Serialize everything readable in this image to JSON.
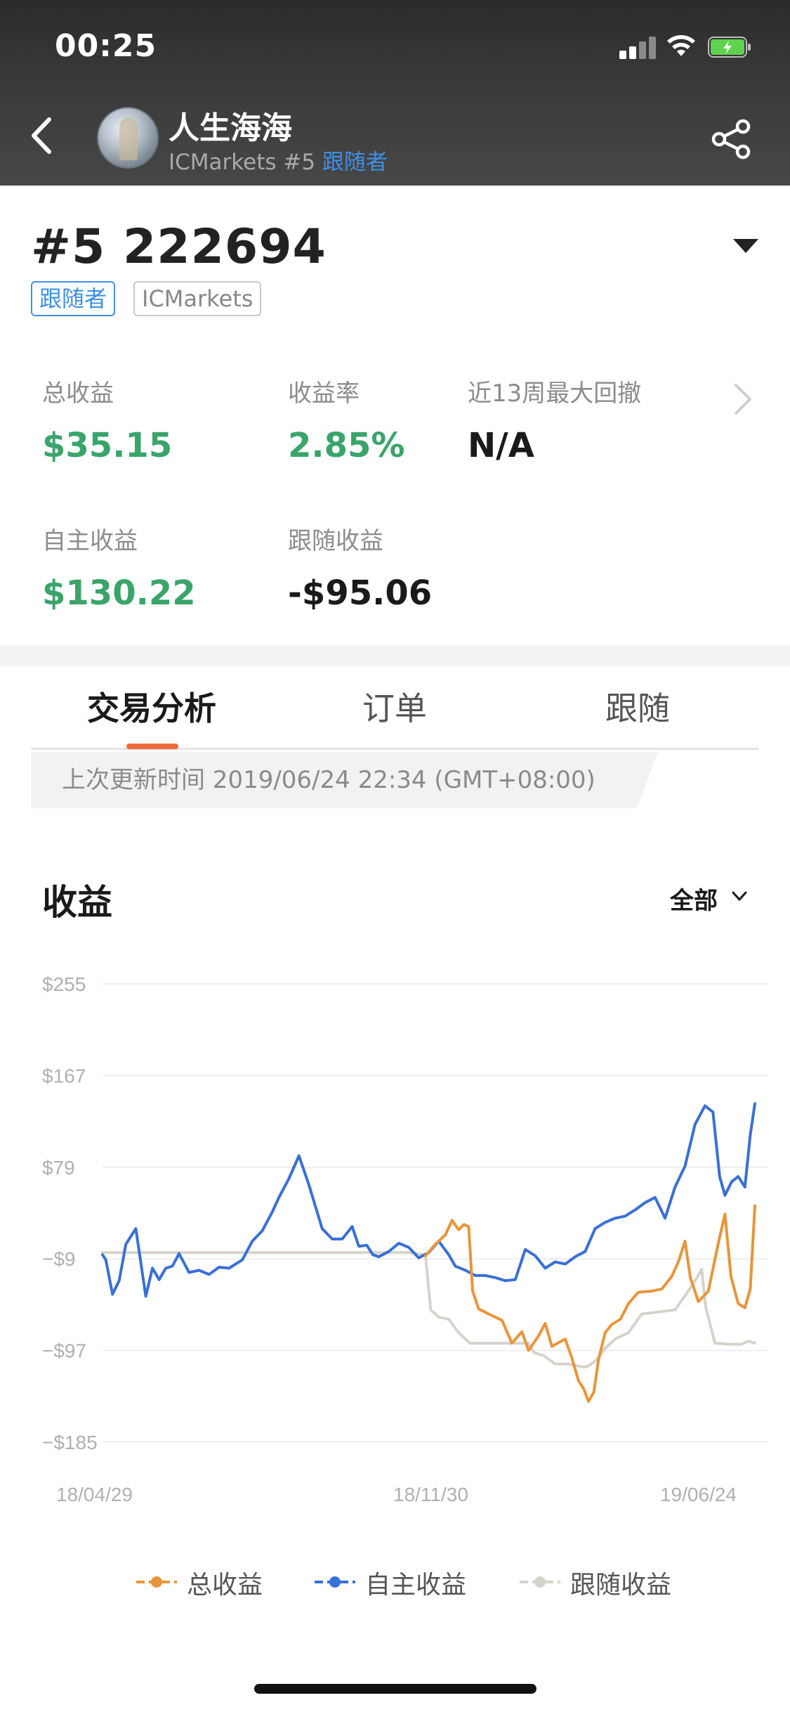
{
  "status_bar": {
    "time": "00:25"
  },
  "header": {
    "user_name": "人生海海",
    "broker_rank": "ICMarkets #5",
    "role": "跟随者"
  },
  "account": {
    "id": "#5 222694",
    "tags": [
      "跟随者",
      "ICMarkets"
    ]
  },
  "stats": {
    "total_profit": {
      "label": "总收益",
      "value": "$35.15"
    },
    "return_rate": {
      "label": "收益率",
      "value": "2.85%"
    },
    "max_drawdown": {
      "label": "近13周最大回撤",
      "value": "N/A"
    },
    "self_profit": {
      "label": "自主收益",
      "value": "$130.22"
    },
    "follow_profit": {
      "label": "跟随收益",
      "value": "-$95.06"
    }
  },
  "tabs": [
    "交易分析",
    "订单",
    "跟随"
  ],
  "update_text": "上次更新时间 2019/06/24 22:34 (GMT+08:00)",
  "chart_section": {
    "title": "收益",
    "filter": "全部"
  },
  "colors": {
    "green": "#3aa46b",
    "orange": "#e8953a",
    "blue": "#3a6fd6",
    "gray": "#d6d3cc",
    "accent": "#ec6b3a",
    "link": "#3f8fe6"
  },
  "chart_data": {
    "type": "line",
    "y_ticks": [
      "$255",
      "$167",
      "$79",
      "−$9",
      "−$97",
      "−$185"
    ],
    "x_ticks": [
      "18/04/29",
      "18/11/30",
      "19/06/24"
    ],
    "ylim": [
      -185,
      255
    ],
    "xlim": [
      0,
      100
    ],
    "grid": true,
    "legend_position": "bottom",
    "series": [
      {
        "name": "总收益",
        "color": "#e8953a",
        "x": [
          48.5,
          50,
          51.5,
          52.5,
          53.5,
          54.3,
          55,
          55.6,
          56.5,
          58,
          60,
          61.5,
          63,
          64,
          65.5,
          66.5,
          67.5,
          69.5,
          70.5,
          71.5,
          72.3,
          73,
          73.8,
          74.5,
          75.5,
          76.5,
          77.8,
          79,
          80.5,
          82.5,
          84,
          85.5,
          86.5,
          87.5,
          88.3,
          89.5,
          91,
          92.5,
          93.5,
          94.4,
          95.5,
          96.5,
          97.3,
          98
        ],
        "y": [
          -6,
          5,
          14,
          28,
          19,
          24,
          22,
          -40,
          -57,
          -62,
          -68,
          -90,
          -79,
          -97,
          -83,
          -71,
          -93,
          -86,
          -104,
          -126,
          -134,
          -146,
          -137,
          -106,
          -80,
          -72,
          -67,
          -52,
          -41,
          -40,
          -38,
          -26,
          -12,
          8,
          -27,
          -50,
          -40,
          6,
          34,
          -26,
          -52,
          -56,
          -38,
          42
        ]
      },
      {
        "name": "自主收益",
        "color": "#3a6fd6",
        "x": [
          0,
          0.5,
          1.5,
          2.5,
          3.5,
          5,
          6.5,
          7.5,
          8.5,
          9.5,
          10.5,
          11.5,
          13,
          14.5,
          16,
          17.5,
          19,
          21,
          22.5,
          24,
          25.5,
          26.5,
          28,
          29.5,
          31,
          33,
          34.5,
          36,
          37.5,
          38.5,
          39.7,
          40.6,
          41.5,
          43,
          44.5,
          46,
          47.5,
          49,
          50.5,
          52,
          53,
          54.5,
          56,
          57.5,
          59,
          60.5,
          62,
          63.5,
          65,
          66.5,
          68,
          69.5,
          71,
          72.5,
          74,
          75.5,
          77,
          78.5,
          80,
          81.5,
          83,
          84.5,
          86,
          87.5,
          89,
          90.5,
          91.7,
          92.7,
          93.5,
          94.5,
          95.5,
          96.5,
          97.3,
          98
        ],
        "y": [
          -5,
          -10,
          -43,
          -30,
          5,
          20,
          -45,
          -18,
          -29,
          -18,
          -16,
          -4,
          -22,
          -20,
          -24,
          -17,
          -18,
          -10,
          8,
          18,
          36,
          50,
          68,
          90,
          62,
          20,
          10,
          10,
          22,
          3,
          4,
          -5,
          -7,
          -2,
          6,
          2,
          -8,
          -3,
          8,
          -5,
          -16,
          -20,
          -25,
          -25,
          -27,
          -30,
          -29,
          0,
          -6,
          -18,
          -12,
          -14,
          -7,
          -2,
          20,
          26,
          30,
          32,
          38,
          45,
          50,
          30,
          60,
          80,
          120,
          138,
          132,
          70,
          52,
          65,
          70,
          60,
          110,
          140
        ]
      },
      {
        "name": "跟随收益",
        "color": "#d6d3cc",
        "x": [
          0,
          10,
          20,
          30,
          40,
          46,
          47.2,
          48.5,
          49.3,
          50.5,
          52,
          53.5,
          55.2,
          57,
          60,
          62.5,
          64,
          64.8,
          66.3,
          68,
          70,
          71.5,
          72.5,
          73.2,
          74.2,
          75.5,
          77,
          79,
          81,
          83.5,
          86,
          88,
          89.4,
          90,
          90.6,
          91.2,
          92,
          94,
          96,
          97,
          98
        ],
        "y": [
          -3,
          -3,
          -3,
          -3,
          -3,
          -3,
          -4,
          -5,
          -58,
          -65,
          -67,
          -80,
          -90,
          -90,
          -90,
          -90,
          -90,
          -99,
          -102,
          -110,
          -110,
          -112,
          -113,
          -111,
          -106,
          -95,
          -86,
          -80,
          -62,
          -60,
          -58,
          -40,
          -26,
          -19,
          -55,
          -70,
          -90,
          -91,
          -91,
          -88,
          -90
        ]
      }
    ]
  }
}
